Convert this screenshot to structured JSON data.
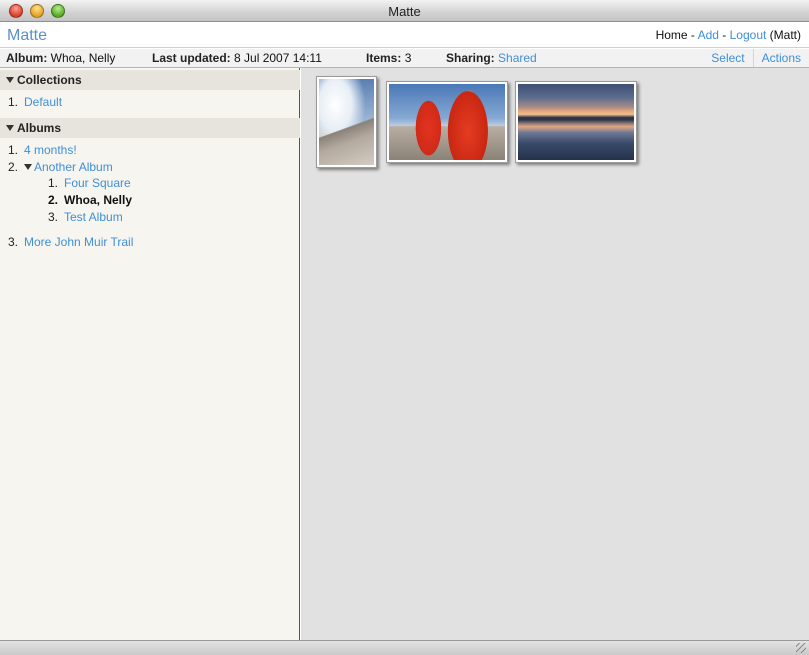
{
  "window": {
    "title": "Matte"
  },
  "header": {
    "app_name": "Matte",
    "nav": {
      "home": "Home",
      "sep1": " - ",
      "add": "Add",
      "sep2": " - ",
      "logout": "Logout",
      "user": " (Matt)"
    }
  },
  "info": {
    "album_label": "Album:",
    "album_value": "Whoa, Nelly",
    "updated_label": "Last updated:",
    "updated_value": "8 Jul 2007 14:11",
    "items_label": "Items:",
    "items_value": "3",
    "sharing_label": "Sharing:",
    "sharing_value": "Shared",
    "actions": [
      "Select",
      "Actions"
    ]
  },
  "sidebar": {
    "collections": {
      "heading": "Collections",
      "items": [
        {
          "num": "1.",
          "label": "Default"
        }
      ]
    },
    "albums": {
      "heading": "Albums",
      "items": [
        {
          "num": "1.",
          "label": "4 months!"
        },
        {
          "num": "2.",
          "label": "Another Album",
          "children": [
            {
              "num": "1.",
              "label": "Four Square"
            },
            {
              "num": "2.",
              "label": "Whoa, Nelly",
              "current": true
            },
            {
              "num": "3.",
              "label": "Test Album"
            }
          ]
        },
        {
          "num": "3.",
          "label": "More John Muir Trail"
        }
      ]
    }
  },
  "main": {
    "thumbnails": [
      {
        "subject": "mountain-ridge-photo"
      },
      {
        "subject": "two-hikers-red-jackets-photo"
      },
      {
        "subject": "lake-sunset-reflection-photo"
      }
    ]
  },
  "colors": {
    "link": "#3f8fd8",
    "app_name": "#5b8fc9",
    "sidebar_bg": "#f6f5ef",
    "main_bg": "#e1e1e1"
  }
}
